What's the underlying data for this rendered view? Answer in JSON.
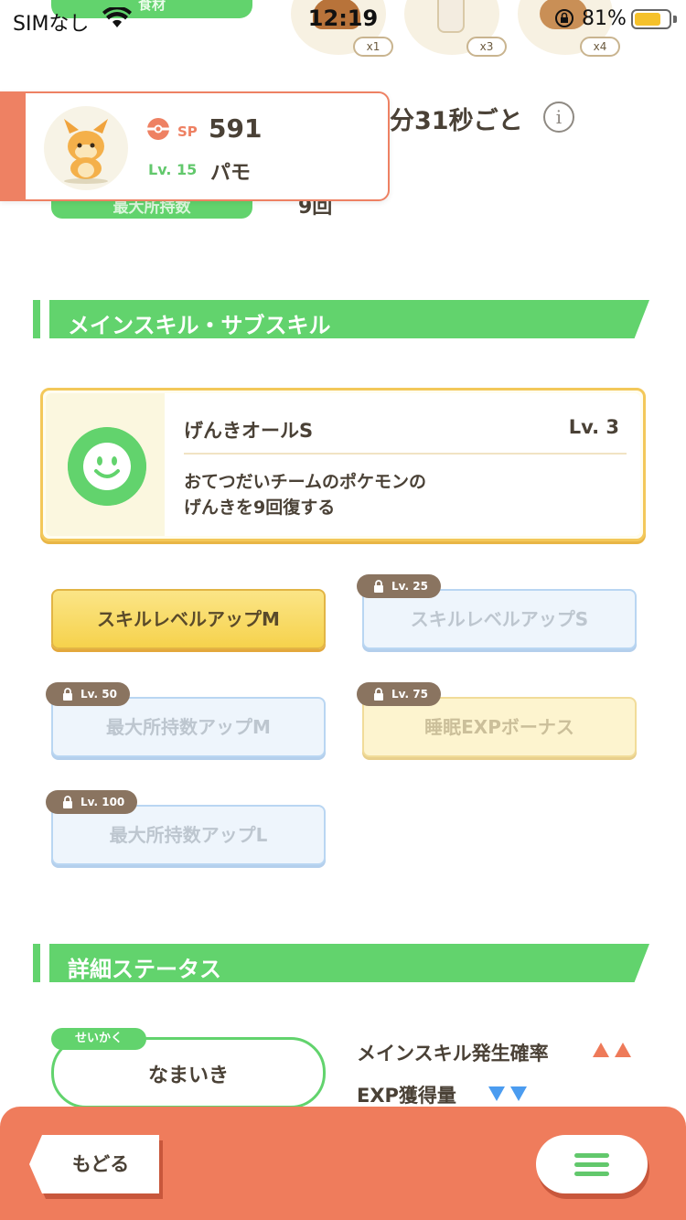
{
  "status_bar": {
    "carrier": "SIMなし",
    "time": "12:19",
    "battery": "81%",
    "battery_level": 0.81
  },
  "ingredients": {
    "label": "食材",
    "items": [
      {
        "icon": "mushroom-icon",
        "count": "x1",
        "color": "#b8733a"
      },
      {
        "icon": "milk-jar-icon",
        "count": "x3",
        "color": "#f3ece0"
      },
      {
        "icon": "bread-icon",
        "count": "x4",
        "color": "#c98f56"
      }
    ]
  },
  "help": {
    "frequency_text": "分31秒ごと",
    "max_carry_label": "最大所持数",
    "max_carry_value": "9回"
  },
  "pokemon_card": {
    "sp_label": "SP",
    "sp_value": "591",
    "level": "Lv. 15",
    "name": "パモ"
  },
  "skills_section": {
    "title": "メインスキル・サブスキル",
    "main_skill": {
      "name": "げんきオールS",
      "level": "Lv. 3",
      "description": "おてつだいチームのポケモンの\nげんきを9回復する",
      "icon": "smiley-icon"
    },
    "sub_skills": [
      {
        "name": "スキルレベルアップM",
        "lock": "",
        "style": "gold"
      },
      {
        "name": "スキルレベルアップS",
        "lock": "Lv. 25",
        "style": "blue"
      },
      {
        "name": "最大所持数アップM",
        "lock": "Lv. 50",
        "style": "blue"
      },
      {
        "name": "睡眠EXPボーナス",
        "lock": "Lv. 75",
        "style": "cream"
      },
      {
        "name": "最大所持数アップL",
        "lock": "Lv. 100",
        "style": "blue"
      }
    ]
  },
  "detail_section": {
    "title": "詳細ステータス",
    "nature_label": "せいかく",
    "nature_value": "なまいき",
    "up_stat": "メインスキル発生確率",
    "down_stat": "EXP獲得量"
  },
  "bottom_bar": {
    "back_label": "もどる",
    "menu_icon": "hamburger-menu-icon"
  },
  "colors": {
    "accent_green": "#62d36d",
    "accent_orange": "#ef7c5c",
    "up_arrow": "#ee7a59",
    "down_arrow": "#4b9cf0"
  }
}
